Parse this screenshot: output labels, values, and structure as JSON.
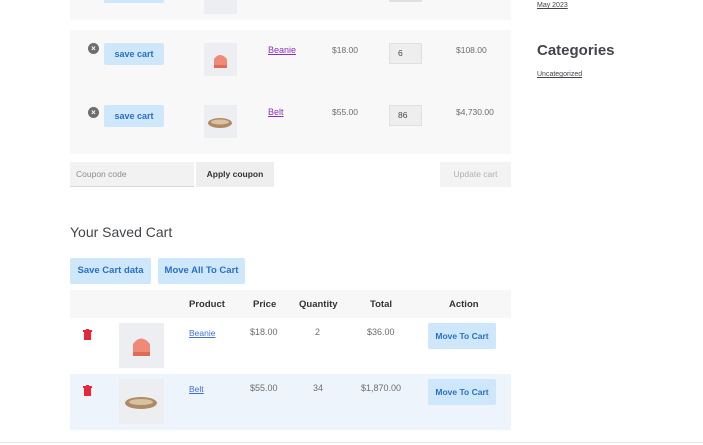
{
  "cart": {
    "rows": [
      {
        "save_label": "save cart",
        "product": "Beanie",
        "price": "$18.00",
        "qty": "6",
        "subtotal": "$108.00"
      },
      {
        "save_label": "save cart",
        "product": "Belt",
        "price": "$55.00",
        "qty": "86",
        "subtotal": "$4,730.00"
      }
    ],
    "coupon_placeholder": "Coupon code",
    "apply_label": "Apply coupon",
    "update_label": "Update cart",
    "remove_glyph": "×"
  },
  "saved": {
    "heading": "Your Saved Cart",
    "save_data_label": "Save Cart data",
    "move_all_label": "Move All To Cart",
    "columns": {
      "product": "Product",
      "price": "Price",
      "quantity": "Quantity",
      "total": "Total",
      "action": "Action"
    },
    "rows": [
      {
        "product": "Beanie",
        "price": "$18.00",
        "qty": "2",
        "total": "$36.00",
        "action": "Move To Cart"
      },
      {
        "product": "Belt",
        "price": "$55.00",
        "qty": "34",
        "total": "$1,870.00",
        "action": "Move To Cart"
      }
    ]
  },
  "sidebar": {
    "archive_link": "May 2023",
    "categories_title": "Categories",
    "category_link": "Uncategorized"
  },
  "icons": {
    "remove": "remove-icon",
    "trash": "trash-icon",
    "product_thumb": "product-thumbnail"
  },
  "colors": {
    "accent_blue": "#cfe7fb",
    "link_purple": "#8a30c2",
    "link_blue": "#3f6fd8",
    "trash_red": "#e8283a"
  }
}
